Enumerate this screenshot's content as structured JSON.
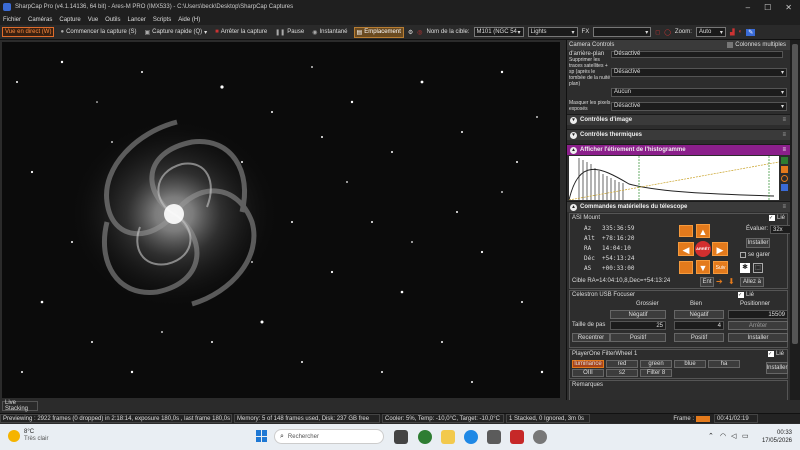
{
  "window": {
    "title": "SharpCap Pro (v4.1.14136, 64 bit) - Ares-M PRO (IMX533) - C:\\Users\\beck\\Desktop\\SharpCap Captures",
    "controls": [
      "–",
      "☐",
      "✕"
    ]
  },
  "menu": [
    "Fichier",
    "Caméras",
    "Capture",
    "Vue",
    "Outils",
    "Lancer",
    "Scripts",
    "Aide (H)"
  ],
  "toolbar": {
    "live": "Vue en direct (W)",
    "start_capture": "Commencer la capture (S)",
    "quick_capture": "Capture rapide (Q)",
    "stop_capture": "Arrêter la capture",
    "pause": "Pause",
    "snapshot": "Instantané",
    "placement": "Emplacement",
    "target_label": "Nom de la cible:",
    "target_value": "M101 (NGC 54",
    "frame_type": "Lights",
    "fx_label": "FX",
    "fx_value": "",
    "zoom_label": "Zoom:",
    "zoom_value": "Auto"
  },
  "panel": {
    "camera_controls": "Camera Controls",
    "multi_columns": "Colonnes multiples",
    "rows": [
      {
        "label": "d'arrière-plan",
        "value": "Désactivé"
      },
      {
        "label": "Supprimer les traces satellites + sp (après le tombée de la nuité plan)",
        "value": "Désactivé"
      },
      {
        "label": "",
        "value": "Aucun"
      },
      {
        "label": "Masquer les pixels exposés",
        "value": "Désactivé"
      }
    ],
    "image_controls": "Contrôles d'image",
    "thermal_controls": "Contrôles thermiques",
    "histogram": "Afficher l'étirement de l'histogramme",
    "telescope": "Commandes matérielles du télescope",
    "mount": {
      "name": "ASI Mount",
      "linked": "Lié",
      "coords": [
        {
          "k": "Az",
          "v": "335:36:59"
        },
        {
          "k": "Alt",
          "v": "+78:16:20"
        },
        {
          "k": "RA",
          "v": "14:04:10"
        },
        {
          "k": "Déc",
          "v": "+54:13:24"
        },
        {
          "k": "AS",
          "v": "+00:33:00"
        }
      ],
      "speed_label": "Évaluer:",
      "speed_value": "32x",
      "install": "Installer",
      "park": "se garer",
      "stop": "ARRÊT",
      "follow": "Suiv",
      "target": "Cible   RA=14:04:10,8,Dec=+54:13:24",
      "go": "Allez à",
      "en": "Ent"
    },
    "focuser": {
      "name": "Celestron USB Focuser",
      "linked": "Lié",
      "col_coarse": "Grossier",
      "col_fine": "Bien",
      "col_position": "Positionner",
      "neg": "Négatif",
      "pos": "Positif",
      "position": "15509",
      "step_label": "Taille de pas",
      "coarse_step": "25",
      "fine_step": "4",
      "stop": "Arrêter",
      "reorder": "Recentrer",
      "install": "Installer"
    },
    "filter": {
      "name": "PlayerOne FilterWheel 1",
      "linked": "Lié",
      "filters": [
        "luminance",
        "red",
        "green",
        "blue",
        "ha",
        "OIII",
        "s2",
        "Filter 8"
      ],
      "install": "Installer"
    },
    "remarks": "Remarques"
  },
  "status": {
    "live_stacking": "Live Stacking",
    "preview": "Previewing : 2922 frames (0 dropped) in 2:18:14, exposure 180,0s , last frame 180,0s",
    "memory": "Memory: 5 of 148 frames used, Disk: 237 GB free",
    "cooler": "Cooler: 5%, Temp: -10,0°C, Target: -10,0°C",
    "stacked": "1 Stacked, 0 Ignored, 3m 0s",
    "frame": "Frame :",
    "time": "00:41/02:19"
  },
  "taskbar": {
    "weather_temp": "8°C",
    "weather_desc": "Très clair",
    "search": "Rechercher",
    "clock_time": "00:33",
    "clock_date": "17/05/2026"
  },
  "colors": {
    "accent": "#e37a1c",
    "purple": "#8b1f8b"
  }
}
